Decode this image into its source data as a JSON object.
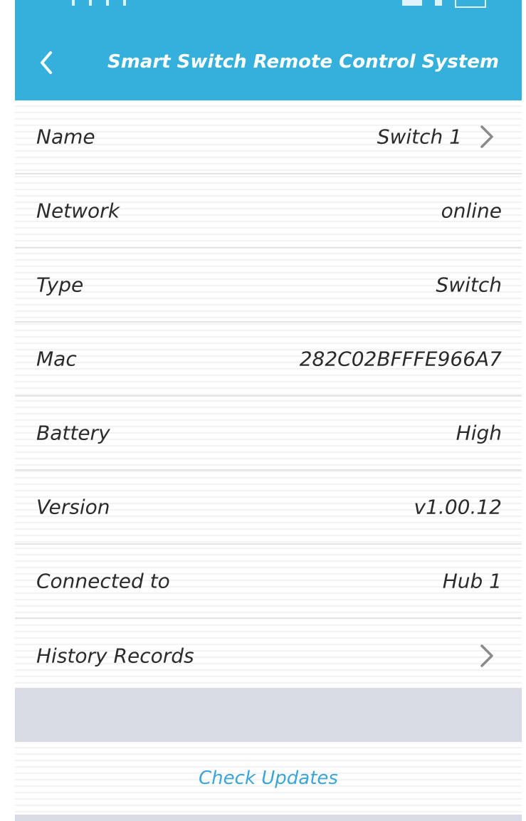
{
  "header": {
    "title": "Smart Switch Remote Control System ...",
    "back_icon": "chevron-left-icon",
    "color": "#35b0dc"
  },
  "rows": [
    {
      "label": "Name",
      "value": "Switch 1",
      "chevron": true
    },
    {
      "label": "Network",
      "value": "online",
      "chevron": false
    },
    {
      "label": "Type",
      "value": "Switch",
      "chevron": false
    },
    {
      "label": "Mac",
      "value": "282C02BFFFE966A7",
      "chevron": false
    },
    {
      "label": "Battery",
      "value": "High",
      "chevron": false
    },
    {
      "label": "Version",
      "value": "v1.00.12",
      "chevron": false
    },
    {
      "label": "Connected to",
      "value": "Hub 1",
      "chevron": false
    },
    {
      "label": "History Records",
      "value": "",
      "chevron": true
    }
  ],
  "footer": {
    "check_updates_label": "Check Updates",
    "link_color": "#3aa6d8"
  }
}
